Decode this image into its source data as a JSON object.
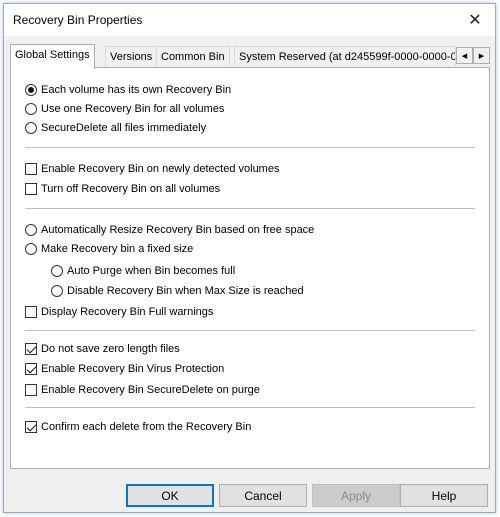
{
  "window": {
    "title": "Recovery Bin Properties"
  },
  "tabs": [
    {
      "label": "Global Settings"
    },
    {
      "label": "Versions"
    },
    {
      "label": "Common Bin"
    },
    {
      "label": "System Reserved (at d245599f-0000-0000-0"
    }
  ],
  "bin_location": {
    "each_volume": "Each volume has its own Recovery Bin",
    "one_bin": "Use one Recovery Bin for all volumes",
    "securedelete": "SecureDelete all files immediately",
    "selected": "each_volume"
  },
  "volumes": {
    "enable_new": {
      "label": "Enable Recovery Bin on newly detected volumes",
      "checked": false
    },
    "turn_off": {
      "label": "Turn off Recovery Bin on all volumes",
      "checked": false
    }
  },
  "size": {
    "auto_resize": "Automatically Resize Recovery Bin based on free space",
    "fixed_size": "Make Recovery bin a fixed size",
    "auto_purge": "Auto Purge when Bin becomes full",
    "disable_max": "Disable Recovery Bin when Max Size is reached",
    "full_warnings": {
      "label": "Display Recovery Bin Full warnings",
      "checked": false
    }
  },
  "files": {
    "zero_length": {
      "label": "Do not save zero length files",
      "checked": true
    },
    "virus": {
      "label": "Enable Recovery Bin Virus Protection",
      "checked": true
    },
    "securedelete_purge": {
      "label": "Enable Recovery Bin SecureDelete on purge",
      "checked": false
    }
  },
  "confirm": {
    "label": "Confirm each delete from the Recovery Bin",
    "checked": true
  },
  "buttons": {
    "ok": "OK",
    "cancel": "Cancel",
    "apply": "Apply",
    "help": "Help"
  },
  "icons": {
    "close": "✕",
    "scroll_left": "◀",
    "scroll_right": "▶"
  }
}
